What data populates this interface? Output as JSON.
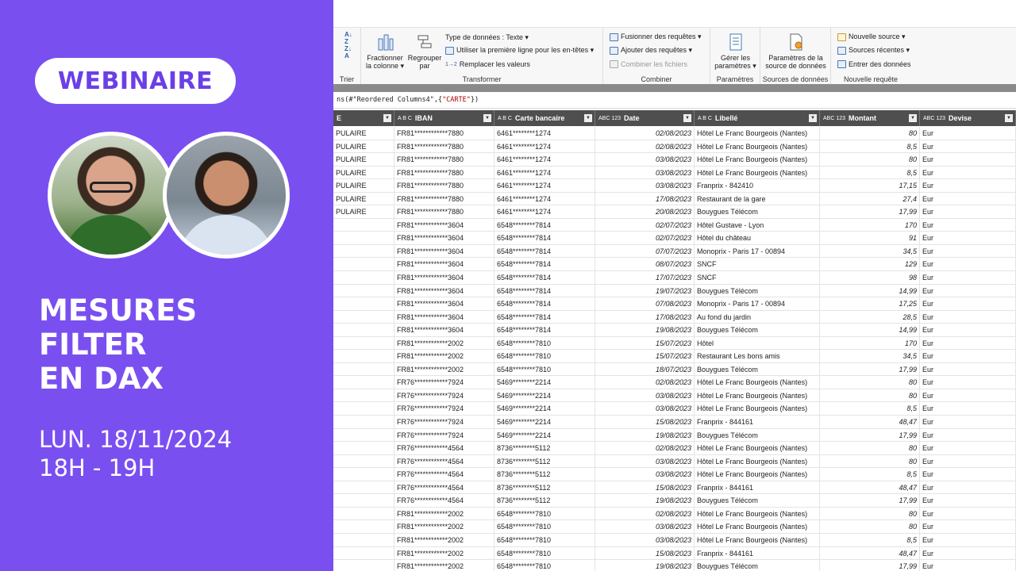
{
  "promo": {
    "badge": "WEBINAIRE",
    "title_lines": [
      "MESURES",
      "FILTER",
      "EN DAX"
    ],
    "date": "LUN. 18/11/2024",
    "time": "18H  -  19H"
  },
  "ribbon": {
    "trier_label": "Trier",
    "transformer": {
      "fractionner": "Fractionner",
      "fractionner_sub": "la colonne ▾",
      "regrouper": "Regrouper",
      "regrouper_sub": "par",
      "type_donnees": "Type de données : Texte ▾",
      "premiere_ligne": "Utiliser la première ligne pour les en-têtes ▾",
      "remplacer": "Remplacer les valeurs",
      "label": "Transformer"
    },
    "combiner": {
      "fusionner": "Fusionner des requêtes ▾",
      "ajouter": "Ajouter des requêtes ▾",
      "combiner_fichiers": "Combiner les fichiers",
      "label": "Combiner"
    },
    "parametres": {
      "gerer": "Gérer les",
      "gerer_sub": "paramètres ▾",
      "label": "Paramètres"
    },
    "sources": {
      "param_source": "Paramètres de la",
      "param_source_sub": "source de données",
      "label": "Sources de données"
    },
    "nouvelle": {
      "nouvelle_source": "Nouvelle source ▾",
      "sources_recentes": "Sources récentes ▾",
      "entrer": "Entrer des données",
      "label": "Nouvelle requête"
    }
  },
  "formula": {
    "prefix": "ns(#\"Reordered Columns4\",{",
    "string": "\"CARTE\"",
    "suffix": "})"
  },
  "columns": {
    "c0": "E",
    "iban": "IBAN",
    "carte": "Carte bancaire",
    "date": "Date",
    "libelle": "Libellé",
    "montant": "Montant",
    "devise": "Devise",
    "abc": "A B C",
    "abc123": "ABC 123"
  },
  "rows": [
    [
      "PULAIRE",
      "FR81************7880",
      "6461********1274",
      "02/08/2023",
      "Hôtel Le Franc Bourgeois (Nantes)",
      "80",
      "Eur"
    ],
    [
      "PULAIRE",
      "FR81************7880",
      "6461********1274",
      "02/08/2023",
      "Hôtel Le Franc Bourgeois (Nantes)",
      "8,5",
      "Eur"
    ],
    [
      "PULAIRE",
      "FR81************7880",
      "6461********1274",
      "03/08/2023",
      "Hôtel Le Franc Bourgeois (Nantes)",
      "80",
      "Eur"
    ],
    [
      "PULAIRE",
      "FR81************7880",
      "6461********1274",
      "03/08/2023",
      "Hôtel Le Franc Bourgeois (Nantes)",
      "8,5",
      "Eur"
    ],
    [
      "PULAIRE",
      "FR81************7880",
      "6461********1274",
      "03/08/2023",
      "Franprix - 842410",
      "17,15",
      "Eur"
    ],
    [
      "PULAIRE",
      "FR81************7880",
      "6461********1274",
      "17/08/2023",
      "Restaurant de la gare",
      "27,4",
      "Eur"
    ],
    [
      "PULAIRE",
      "FR81************7880",
      "6461********1274",
      "20/08/2023",
      "Bouygues Télécom",
      "17,99",
      "Eur"
    ],
    [
      "",
      "FR81************3604",
      "6548********7814",
      "02/07/2023",
      "Hôtel Gustave - Lyon",
      "170",
      "Eur"
    ],
    [
      "",
      "FR81************3604",
      "6548********7814",
      "02/07/2023",
      "Hôtel du château",
      "91",
      "Eur"
    ],
    [
      "",
      "FR81************3604",
      "6548********7814",
      "07/07/2023",
      "Monoprix - Paris 17 - 00894",
      "34,5",
      "Eur"
    ],
    [
      "",
      "FR81************3604",
      "6548********7814",
      "08/07/2023",
      "SNCF",
      "129",
      "Eur"
    ],
    [
      "",
      "FR81************3604",
      "6548********7814",
      "17/07/2023",
      "SNCF",
      "98",
      "Eur"
    ],
    [
      "",
      "FR81************3604",
      "6548********7814",
      "19/07/2023",
      "Bouygues Télécom",
      "14,99",
      "Eur"
    ],
    [
      "",
      "FR81************3604",
      "6548********7814",
      "07/08/2023",
      "Monoprix - Paris 17 - 00894",
      "17,25",
      "Eur"
    ],
    [
      "",
      "FR81************3604",
      "6548********7814",
      "17/08/2023",
      "Au fond du jardin",
      "28,5",
      "Eur"
    ],
    [
      "",
      "FR81************3604",
      "6548********7814",
      "19/08/2023",
      "Bouygues Télécom",
      "14,99",
      "Eur"
    ],
    [
      "",
      "FR81************2002",
      "6548********7810",
      "15/07/2023",
      "Hôtel",
      "170",
      "Eur"
    ],
    [
      "",
      "FR81************2002",
      "6548********7810",
      "15/07/2023",
      "Restaurant Les bons amis",
      "34,5",
      "Eur"
    ],
    [
      "",
      "FR81************2002",
      "6548********7810",
      "18/07/2023",
      "Bouygues Télécom",
      "17,99",
      "Eur"
    ],
    [
      "",
      "FR76************7924",
      "5469********2214",
      "02/08/2023",
      "Hôtel Le Franc Bourgeois (Nantes)",
      "80",
      "Eur"
    ],
    [
      "",
      "FR76************7924",
      "5469********2214",
      "03/08/2023",
      "Hôtel Le Franc Bourgeois (Nantes)",
      "80",
      "Eur"
    ],
    [
      "",
      "FR76************7924",
      "5469********2214",
      "03/08/2023",
      "Hôtel Le Franc Bourgeois (Nantes)",
      "8,5",
      "Eur"
    ],
    [
      "",
      "FR76************7924",
      "5469********2214",
      "15/08/2023",
      "Franprix - 844161",
      "48,47",
      "Eur"
    ],
    [
      "",
      "FR76************7924",
      "5469********2214",
      "19/08/2023",
      "Bouygues Télécom",
      "17,99",
      "Eur"
    ],
    [
      "",
      "FR76************4564",
      "8736********5112",
      "02/08/2023",
      "Hôtel Le Franc Bourgeois (Nantes)",
      "80",
      "Eur"
    ],
    [
      "",
      "FR76************4564",
      "8736********5112",
      "03/08/2023",
      "Hôtel Le Franc Bourgeois (Nantes)",
      "80",
      "Eur"
    ],
    [
      "",
      "FR76************4564",
      "8736********5112",
      "03/08/2023",
      "Hôtel Le Franc Bourgeois (Nantes)",
      "8,5",
      "Eur"
    ],
    [
      "",
      "FR76************4564",
      "8736********5112",
      "15/08/2023",
      "Franprix - 844161",
      "48,47",
      "Eur"
    ],
    [
      "",
      "FR76************4564",
      "8736********5112",
      "19/08/2023",
      "Bouygues Télécom",
      "17,99",
      "Eur"
    ],
    [
      "",
      "FR81************2002",
      "6548********7810",
      "02/08/2023",
      "Hôtel Le Franc Bourgeois (Nantes)",
      "80",
      "Eur"
    ],
    [
      "",
      "FR81************2002",
      "6548********7810",
      "03/08/2023",
      "Hôtel Le Franc Bourgeois (Nantes)",
      "80",
      "Eur"
    ],
    [
      "",
      "FR81************2002",
      "6548********7810",
      "03/08/2023",
      "Hôtel Le Franc Bourgeois (Nantes)",
      "8,5",
      "Eur"
    ],
    [
      "",
      "FR81************2002",
      "6548********7810",
      "15/08/2023",
      "Franprix - 844161",
      "48,47",
      "Eur"
    ],
    [
      "",
      "FR81************2002",
      "6548********7810",
      "19/08/2023",
      "Bouygues Télécom",
      "17,99",
      "Eur"
    ]
  ],
  "colors": {
    "promo_bg": "#7a4ff0",
    "badge_text": "#6b3fe6",
    "header_bg": "#4f4f4f"
  }
}
